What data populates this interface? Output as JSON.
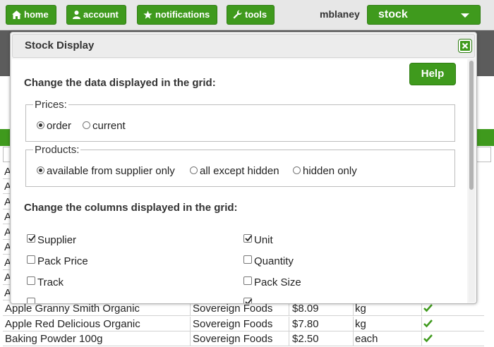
{
  "nav": {
    "home": "home",
    "account": "account",
    "notifications": "notifications",
    "tools": "tools",
    "username": "mblaney",
    "selected_module": "stock"
  },
  "colors": {
    "accent": "#3f9a1d",
    "dark_panel": "#5c5c5c"
  },
  "dialog": {
    "title": "Stock Display",
    "help_label": "Help",
    "grid_data_heading": "Change the data displayed in the grid:",
    "prices": {
      "legend": "Prices:",
      "options": [
        "order",
        "current"
      ],
      "selected": "order"
    },
    "products": {
      "legend": "Products:",
      "options": [
        "available from supplier only",
        "all except hidden",
        "hidden only"
      ],
      "selected": "available from supplier only"
    },
    "columns_heading": "Change the columns displayed in the grid:",
    "columns": [
      {
        "label": "Supplier",
        "checked": true
      },
      {
        "label": "Unit",
        "checked": true
      },
      {
        "label": "Pack Price",
        "checked": false
      },
      {
        "label": "Quantity",
        "checked": false
      },
      {
        "label": "Track",
        "checked": false
      },
      {
        "label": "Pack Size",
        "checked": false
      }
    ]
  },
  "grid": {
    "row_stubs": [
      "A",
      "A",
      "A",
      "A",
      "A",
      "A",
      "A",
      "A",
      "A"
    ],
    "rows": [
      {
        "product": "Apple Granny Smith Organic",
        "supplier": "Sovereign Foods",
        "price": "$8.09",
        "unit": "kg"
      },
      {
        "product": "Apple Red Delicious Organic",
        "supplier": "Sovereign Foods",
        "price": "$7.80",
        "unit": "kg"
      },
      {
        "product": "Baking Powder 100g",
        "supplier": "Sovereign Foods",
        "price": "$2.50",
        "unit": "each"
      }
    ]
  }
}
